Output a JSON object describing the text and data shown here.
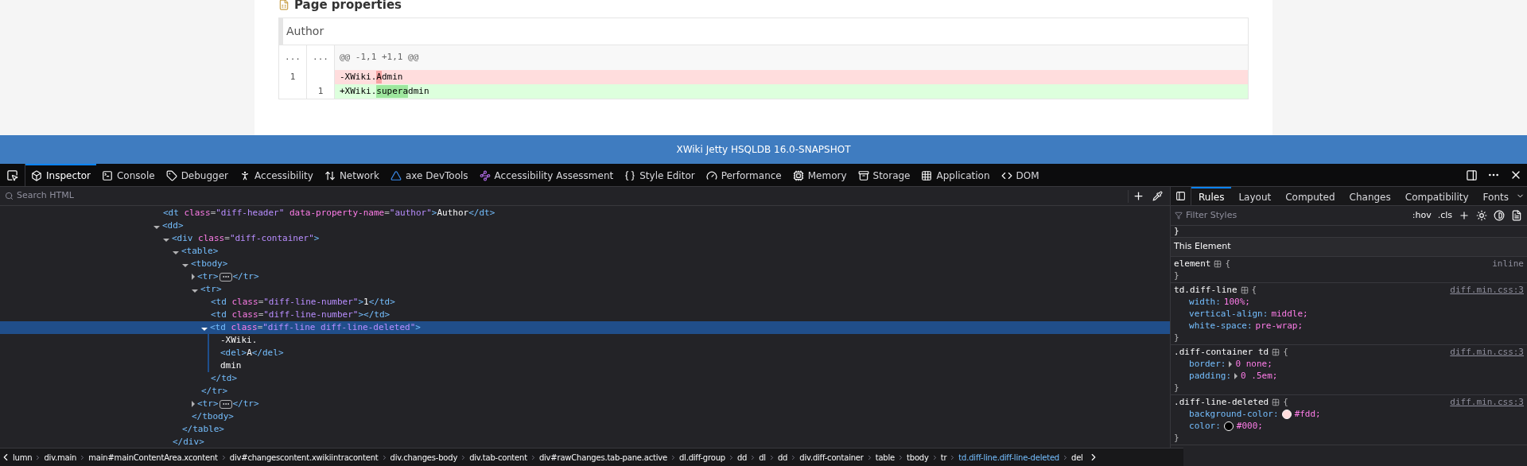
{
  "page": {
    "heading": "Page properties",
    "diff": {
      "header": "Author",
      "rows": [
        {
          "kind": "hunk",
          "old": "...",
          "new": "...",
          "segments": [
            {
              "text": "@@ -1,1 +1,1 @@"
            }
          ]
        },
        {
          "kind": "deleted",
          "old": "1",
          "new": "",
          "segments": [
            {
              "text": "-XWiki.",
              "changed": false
            },
            {
              "text": "A",
              "changed": true
            },
            {
              "text": "dmin",
              "changed": false
            }
          ]
        },
        {
          "kind": "added",
          "old": "",
          "new": "1",
          "segments": [
            {
              "text": "+XWiki.",
              "changed": false
            },
            {
              "text": "supera",
              "changed": true
            },
            {
              "text": "dmin",
              "changed": false
            }
          ]
        }
      ]
    }
  },
  "window": {
    "title": "XWiki Jetty HSQLDB 16.0-SNAPSHOT"
  },
  "devtools": {
    "tabs": [
      {
        "label": "Inspector",
        "selected": true
      },
      {
        "label": "Console",
        "selected": false
      },
      {
        "label": "Debugger",
        "selected": false
      },
      {
        "label": "Accessibility",
        "selected": false
      },
      {
        "label": "Network",
        "selected": false
      },
      {
        "label": "axe DevTools",
        "selected": false
      },
      {
        "label": "Accessibility Assessment",
        "selected": false
      },
      {
        "label": "Style Editor",
        "selected": false
      },
      {
        "label": "Performance",
        "selected": false
      },
      {
        "label": "Memory",
        "selected": false
      },
      {
        "label": "Storage",
        "selected": false
      },
      {
        "label": "Application",
        "selected": false
      },
      {
        "label": "DOM",
        "selected": false
      }
    ],
    "search": {
      "placeholder": "Search HTML"
    },
    "html_tree": [
      {
        "text": "<dt class=\"diff-header\" data-property-name=\"author\">Author</dt>",
        "selected": false
      },
      {
        "text": "<dd>",
        "expanded": true,
        "selected": false,
        "children": [
          {
            "text": "<div class=\"diff-container\">",
            "expanded": true,
            "selected": false,
            "close": "</div>",
            "children": [
              {
                "text": "<table>",
                "expanded": true,
                "selected": false,
                "close": "</table>",
                "children": [
                  {
                    "text": "<tbody>",
                    "expanded": true,
                    "selected": false,
                    "close": "</tbody>",
                    "children": [
                      {
                        "text": "<tr>",
                        "expanded": false,
                        "selected": false,
                        "close": "</tr>"
                      },
                      {
                        "text": "<tr>",
                        "expanded": true,
                        "selected": false,
                        "close": "</tr>",
                        "children": [
                          {
                            "text": "<td class=\"diff-line-number\">1</td>",
                            "selected": false
                          },
                          {
                            "text": "<td class=\"diff-line-number\"></td>",
                            "selected": false
                          },
                          {
                            "text": "<td class=\"diff-line diff-line-deleted\">",
                            "expanded": true,
                            "selected": true,
                            "close": "</td>",
                            "children": [
                              {
                                "text": "-XWiki.",
                                "selected": false
                              },
                              {
                                "text": "<del>A</del>",
                                "selected": false
                              },
                              {
                                "text": "dmin",
                                "selected": false
                              }
                            ]
                          }
                        ]
                      },
                      {
                        "text": "<tr>",
                        "expanded": false,
                        "selected": false,
                        "close": "</tr>"
                      }
                    ]
                  }
                ]
              }
            ]
          }
        ]
      }
    ],
    "side_tabs": [
      {
        "label": "Rules",
        "selected": true
      },
      {
        "label": "Layout",
        "selected": false
      },
      {
        "label": "Computed",
        "selected": false
      },
      {
        "label": "Changes",
        "selected": false
      },
      {
        "label": "Compatibility",
        "selected": false
      },
      {
        "label": "Fonts",
        "selected": false
      }
    ],
    "filter": {
      "placeholder": "Filter Styles",
      "hov": ":hov",
      "cls": ".cls"
    },
    "rules_top_close": "}",
    "section": "This Element",
    "rules": [
      {
        "selector": "element",
        "open": "{",
        "close": "}",
        "source": "inline",
        "link": false
      },
      {
        "selector": "td.diff-line",
        "open": "{",
        "close": "}",
        "source": "diff.min.css:3",
        "link": true,
        "declarations": [
          {
            "property": "width:",
            "value": "100%;"
          },
          {
            "property": "vertical-align:",
            "value": "middle;"
          },
          {
            "property": "white-space:",
            "value": "pre-wrap;"
          }
        ]
      },
      {
        "selector": ".diff-container td",
        "open": "{",
        "close": "}",
        "source": "diff.min.css:3",
        "link": true,
        "declarations": [
          {
            "property": "border:",
            "value": "0 none;",
            "expandable": true
          },
          {
            "property": "padding:",
            "value": "0 .5em;",
            "expandable": true
          }
        ]
      },
      {
        "selector": ".diff-line-deleted",
        "open": "{",
        "close": "}",
        "source": "diff.min.css:3",
        "link": true,
        "declarations": [
          {
            "property": "background-color:",
            "value": "#fdd;",
            "color": "#ffdddd"
          },
          {
            "property": "color:",
            "value": "#000;",
            "color": "#000000"
          }
        ]
      }
    ],
    "breadcrumbs": [
      {
        "label": "lumn",
        "selected": false
      },
      {
        "label": "div.main",
        "selected": false
      },
      {
        "label": "main#mainContentArea.xcontent",
        "selected": false
      },
      {
        "label": "div#changescontent.xwikiintracontent",
        "selected": false
      },
      {
        "label": "div.changes-body",
        "selected": false
      },
      {
        "label": "div.tab-content",
        "selected": false
      },
      {
        "label": "div#rawChanges.tab-pane.active",
        "selected": false
      },
      {
        "label": "dl.diff-group",
        "selected": false
      },
      {
        "label": "dd",
        "selected": false
      },
      {
        "label": "dl",
        "selected": false
      },
      {
        "label": "dd",
        "selected": false
      },
      {
        "label": "div.diff-container",
        "selected": false
      },
      {
        "label": "table",
        "selected": false
      },
      {
        "label": "tbody",
        "selected": false
      },
      {
        "label": "tr",
        "selected": false
      },
      {
        "label": "td.diff-line.diff-line-deleted",
        "selected": true
      },
      {
        "label": "del",
        "selected": false
      }
    ]
  }
}
